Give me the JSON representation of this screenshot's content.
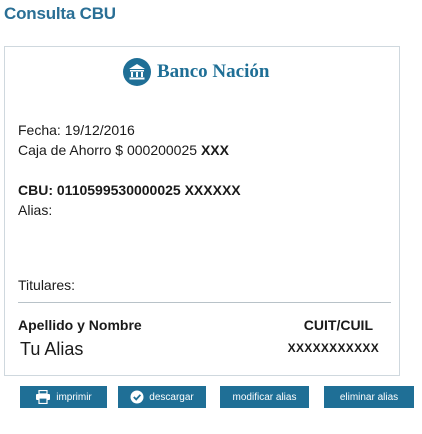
{
  "page": {
    "title": "Consulta CBU"
  },
  "brand": {
    "name": "Banco Nación",
    "logo_icon": "bank-building-icon",
    "color": "#1f6f96"
  },
  "account": {
    "date_label": "Fecha:",
    "date": "19/12/2016",
    "account_type": "Caja de Ahorro $ 000200025",
    "account_mask": "XXX",
    "cbu_label": "CBU:",
    "cbu_number": "0110599530000025",
    "cbu_mask": "XXXXXX",
    "alias_label": "Alias:"
  },
  "holders": {
    "section_label": "Titulares:",
    "columns": [
      "Apellido y Nombre",
      "CUIT/CUIL"
    ],
    "rows": [
      {
        "name": "Tu Alias",
        "cuit": "XXXXXXXXXXX"
      }
    ]
  },
  "buttons": {
    "print": {
      "label": "imprimir",
      "icon": "printer-icon"
    },
    "download": {
      "label": "descargar",
      "icon": "download-check-icon"
    },
    "modify_alias": {
      "label": "modificar alias"
    },
    "delete_alias": {
      "label": "eliminar alias"
    }
  },
  "colors": {
    "accent": "#1f6f96",
    "title": "#2a6f95"
  }
}
